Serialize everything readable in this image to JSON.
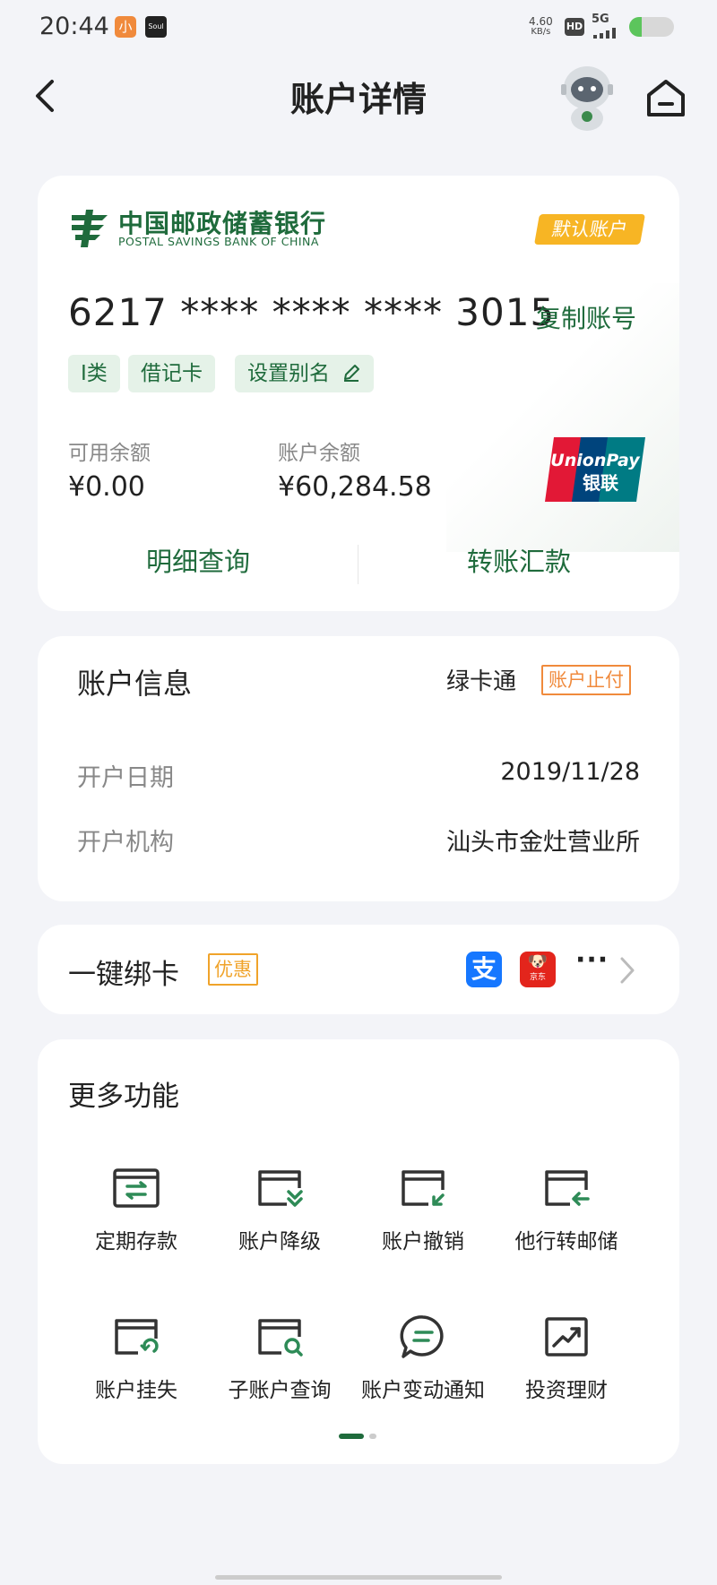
{
  "status_bar": {
    "time": "20:44",
    "app_icon_1": "小",
    "app_icon_2": "Soul",
    "speed_value": "4.60",
    "speed_unit": "KB/s",
    "hd": "HD",
    "network": "5G"
  },
  "header": {
    "title": "账户详情"
  },
  "account_card": {
    "bank_name_cn": "中国邮政储蓄银行",
    "bank_name_en": "POSTAL SAVINGS BANK OF CHINA",
    "default_badge": "默认账户",
    "card_number": "6217 **** **** **** 3015",
    "copy_label": "复制账号",
    "tags": [
      "I类",
      "借记卡",
      "设置别名"
    ],
    "available_label": "可用余额",
    "available_value": "¥0.00",
    "balance_label": "账户余额",
    "balance_value": "¥60,284.58",
    "card_network": "UnionPay 银联",
    "actions": [
      "明细查询",
      "转账汇款"
    ]
  },
  "account_info": {
    "title": "账户信息",
    "card_type": "绿卡通",
    "status_badge": "账户止付",
    "rows": [
      {
        "label": "开户日期",
        "value": "2019/11/28"
      },
      {
        "label": "开户机构",
        "value": "汕头市金灶营业所"
      }
    ]
  },
  "bind_card": {
    "title": "一键绑卡",
    "promo_badge": "优惠",
    "alipay_glyph": "支",
    "jd_text": "京东",
    "more_glyph": "···"
  },
  "more_functions": {
    "title": "更多功能",
    "items": [
      {
        "label": "定期存款",
        "icon": "fixed-deposit-icon"
      },
      {
        "label": "账户降级",
        "icon": "account-downgrade-icon"
      },
      {
        "label": "账户撤销",
        "icon": "account-cancel-icon"
      },
      {
        "label": "他行转邮储",
        "icon": "transfer-in-icon"
      },
      {
        "label": "账户挂失",
        "icon": "report-loss-icon"
      },
      {
        "label": "子账户查询",
        "icon": "sub-account-search-icon"
      },
      {
        "label": "账户变动通知",
        "icon": "change-notify-icon"
      },
      {
        "label": "投资理财",
        "icon": "investment-icon"
      }
    ]
  },
  "colors": {
    "brand_green": "#1f6b3c",
    "badge_yellow": "#f7b524",
    "warn_orange": "#f08a3c",
    "background": "#f3f4f8"
  }
}
